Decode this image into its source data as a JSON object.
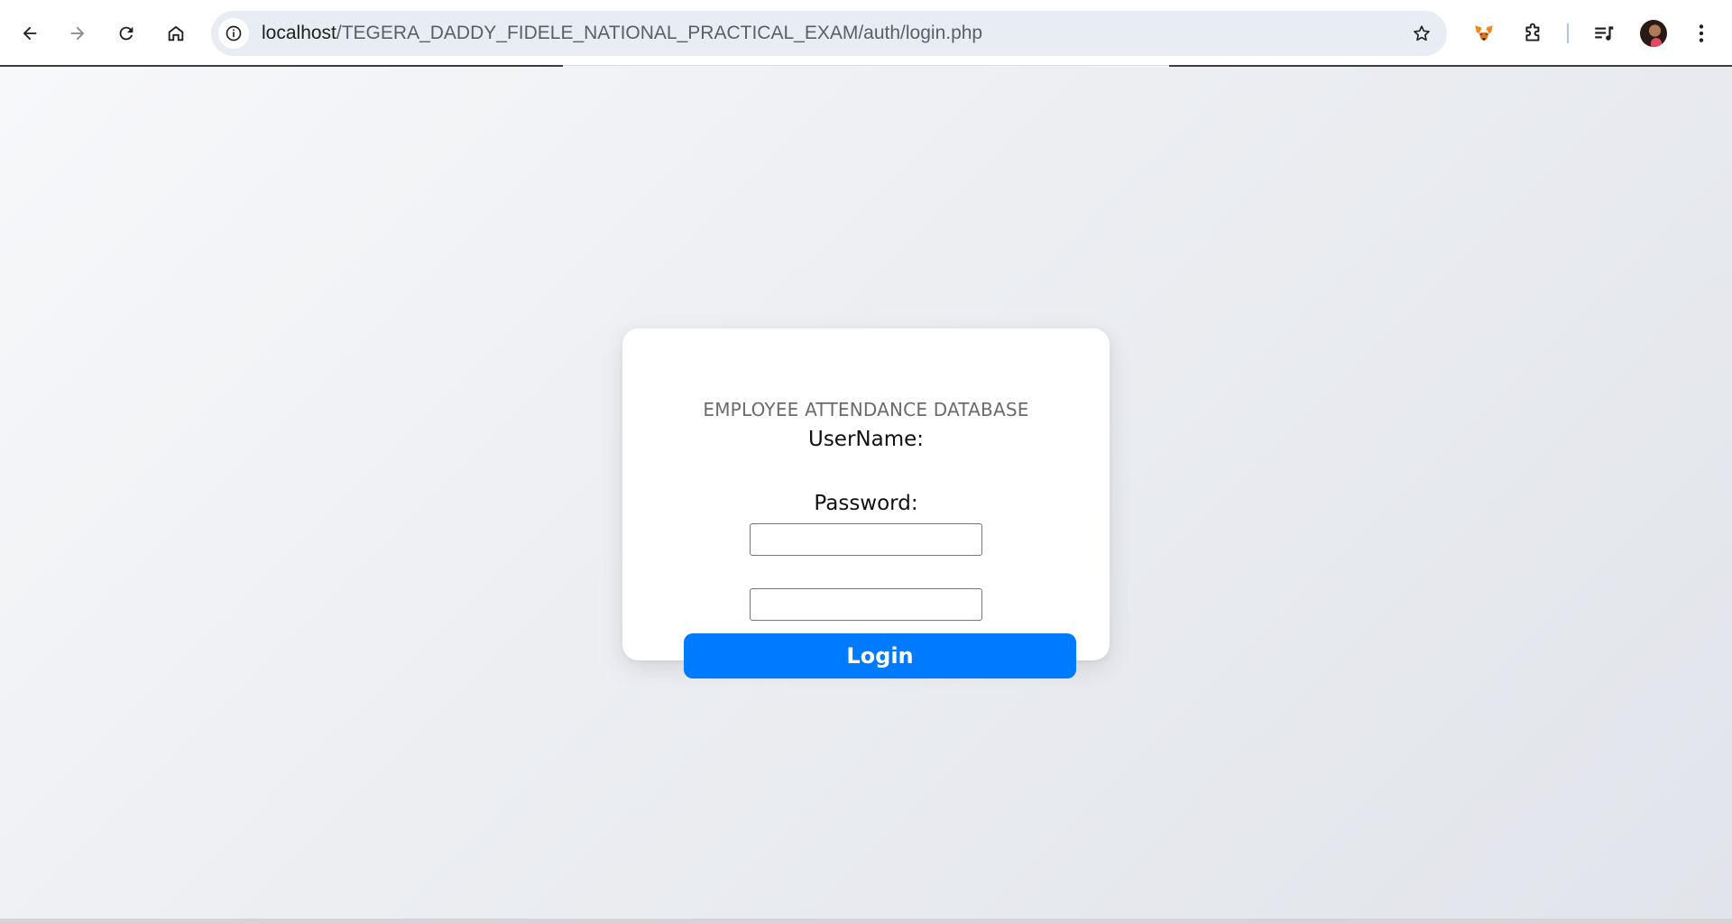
{
  "browser": {
    "url_host": "localhost",
    "url_path": "/TEGERA_DADDY_FIDELE_NATIONAL_PRACTICAL_EXAM/auth/login.php",
    "icons": {
      "back": "arrow-left-icon",
      "forward": "arrow-right-icon",
      "reload": "reload-icon",
      "home": "home-icon",
      "site_info": "info-icon",
      "bookmark": "star-icon",
      "metamask": "fox-icon",
      "extensions": "puzzle-icon",
      "media": "media-queue-icon",
      "profile": "avatar",
      "menu": "kebab-menu-icon"
    }
  },
  "login": {
    "title": "EMPLOYEE ATTENDANCE DATABASE",
    "username_label": "UserName:",
    "username_value": "",
    "password_label": "Password:",
    "password_value": "",
    "button_label": "Login"
  },
  "colors": {
    "accent": "#007bff",
    "card_bg": "#ffffff",
    "title_text": "#6b6b6b"
  }
}
